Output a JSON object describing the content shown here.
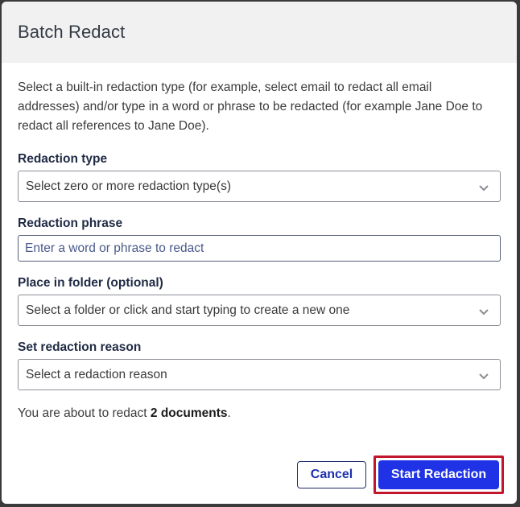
{
  "dialog": {
    "title": "Batch Redact",
    "intro": "Select a built-in redaction type (for example, select email to redact all email addresses) and/or type in a word or phrase to be redacted (for example Jane Doe to redact all references to Jane Doe)."
  },
  "fields": {
    "redaction_type": {
      "label": "Redaction type",
      "placeholder": "Select zero or more redaction type(s)"
    },
    "redaction_phrase": {
      "label": "Redaction phrase",
      "placeholder": "Enter a word or phrase to redact",
      "value": ""
    },
    "folder": {
      "label": "Place in folder (optional)",
      "placeholder": "Select a folder or click and start typing to create a new one"
    },
    "reason": {
      "label": "Set redaction reason",
      "placeholder": "Select a redaction reason"
    }
  },
  "summary": {
    "prefix": "You are about to redact ",
    "count_text": "2 documents",
    "suffix": "."
  },
  "footer": {
    "cancel_label": "Cancel",
    "start_label": "Start Redaction"
  },
  "icons": {
    "dropdown": "chevron-down-icon"
  },
  "colors": {
    "primary": "#1f32e6",
    "highlight": "#c0172e",
    "header_bg": "#f1f1f2"
  }
}
